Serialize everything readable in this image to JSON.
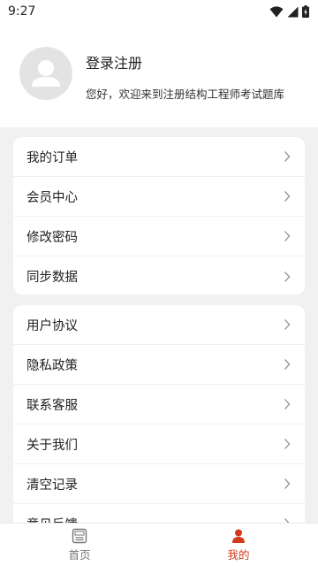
{
  "status_bar": {
    "time": "9:27",
    "icons": [
      "wifi-icon",
      "signal-icon",
      "battery-charging-icon"
    ]
  },
  "profile": {
    "avatar_icon": "user-avatar-icon",
    "title": "登录注册",
    "welcome": "您好，欢迎来到注册结构工程师考试题库"
  },
  "menu_group_1": {
    "items": [
      {
        "label": "我的订单"
      },
      {
        "label": "会员中心"
      },
      {
        "label": "修改密码"
      },
      {
        "label": "同步数据"
      }
    ]
  },
  "menu_group_2": {
    "items": [
      {
        "label": "用户协议"
      },
      {
        "label": "隐私政策"
      },
      {
        "label": "联系客服"
      },
      {
        "label": "关于我们"
      },
      {
        "label": "清空记录"
      },
      {
        "label": "意见反馈"
      }
    ]
  },
  "bottom_nav": {
    "home": {
      "label": "首页",
      "icon": "home-exam-icon"
    },
    "mine": {
      "label": "我的",
      "icon": "person-icon"
    }
  },
  "colors": {
    "accent": "#d23a1e",
    "background": "#f1f1f1",
    "card": "#ffffff",
    "muted": "#777777"
  }
}
